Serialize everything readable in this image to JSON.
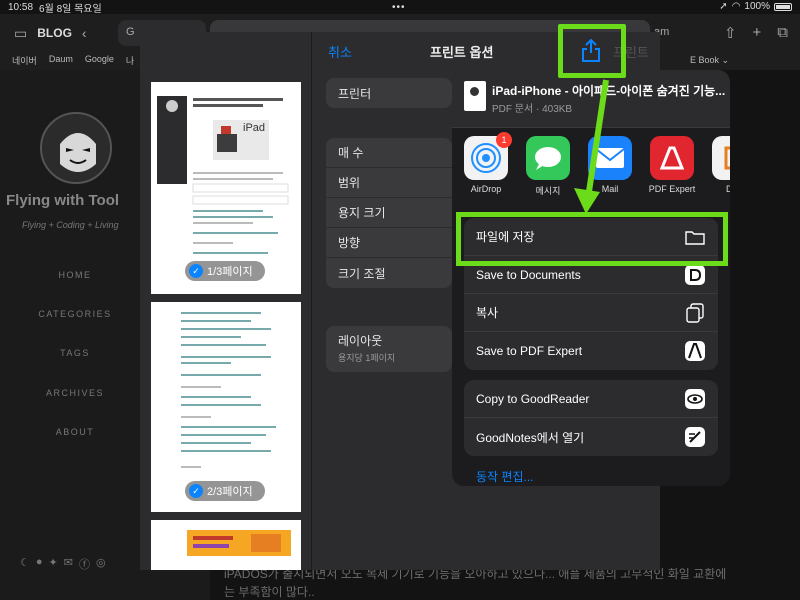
{
  "status": {
    "time": "10:58",
    "date": "6월 8일 목요일",
    "battery": "100%"
  },
  "browser": {
    "site_label": "BLOG",
    "tab_left": "G",
    "tab_right": "am",
    "bookmarks": [
      "네이버",
      "Daum",
      "Google",
      "나"
    ],
    "bookmark_right": "E Book ⌄"
  },
  "blog": {
    "title": "Flying with Tool",
    "subtitle": "Flying + Coding + Living",
    "nav": [
      "HOME",
      "CATEGORIES",
      "TAGS",
      "ARCHIVES",
      "ABOUT"
    ],
    "bottom_line1": "iPADOS가 출시되면서 오도 복제 기기로 기능을 오아하고 있으나... 애플 제품의 고무적인 화일 교환에",
    "bottom_line2": "는 부족함이 많다.."
  },
  "print_sheet": {
    "cancel": "취소",
    "title": "프린트 옵션",
    "print": "프린트",
    "printer_label": "프린터",
    "options": [
      "매 수",
      "범위",
      "용지 크기",
      "방향",
      "크기 조절"
    ],
    "layout_label": "레이아웃",
    "layout_sub": "용지당 1페이지",
    "page_badges": [
      "1/3페이지",
      "2/3페이지"
    ],
    "page1_banner": "iPad"
  },
  "share": {
    "doc_title": "iPad-iPhone - 아이패드-아이폰 숨겨진 기능...",
    "doc_meta": "PDF 문서 · 403KB",
    "apps": [
      {
        "name": "AirDrop",
        "badge": "1",
        "color": "#1e90ff"
      },
      {
        "name": "메시지",
        "color": "#34c759"
      },
      {
        "name": "Mail",
        "color": "#1a82fb"
      },
      {
        "name": "PDF Expert",
        "color": "#e2262f"
      },
      {
        "name": "Doc",
        "color": "#f2f2f2"
      }
    ],
    "group1": [
      "파일에 저장",
      "Save to Documents",
      "복사",
      "Save to PDF Expert"
    ],
    "group2": [
      "Copy to GoodReader",
      "GoodNotes에서 열기"
    ],
    "edit_actions": "동작 편집..."
  },
  "colors": {
    "highlight": "#6bdb1a",
    "accent": "#0a84ff"
  }
}
